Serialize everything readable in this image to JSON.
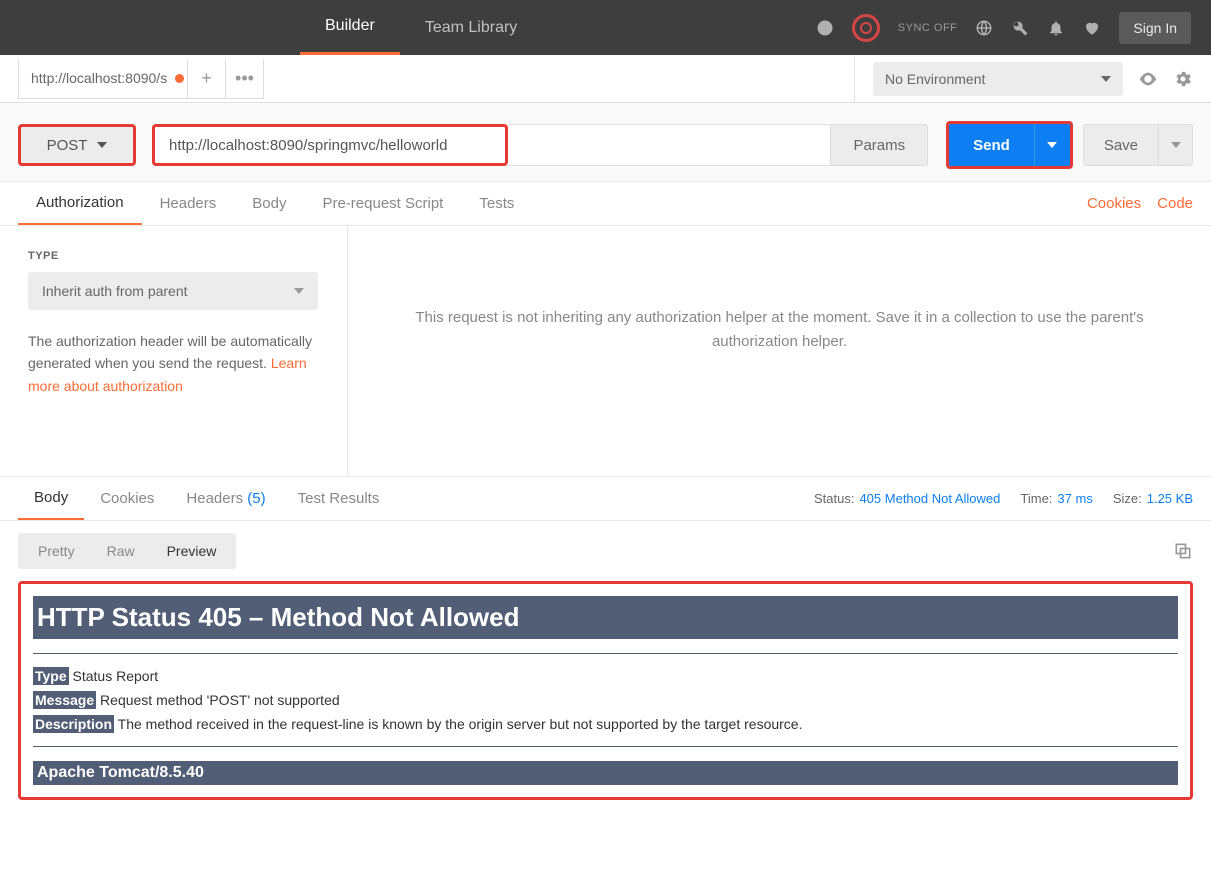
{
  "header": {
    "tabs": {
      "builder": "Builder",
      "teamLibrary": "Team Library"
    },
    "sync": "SYNC OFF",
    "signIn": "Sign In"
  },
  "fileTab": {
    "label": "http://localhost:8090/s"
  },
  "env": {
    "selected": "No Environment"
  },
  "request": {
    "method": "POST",
    "url": "http://localhost:8090/springmvc/helloworld",
    "params": "Params",
    "send": "Send",
    "save": "Save"
  },
  "reqTabs": {
    "authorization": "Authorization",
    "headers": "Headers",
    "body": "Body",
    "preRequest": "Pre-request Script",
    "tests": "Tests",
    "cookies": "Cookies",
    "code": "Code"
  },
  "auth": {
    "typeLabel": "TYPE",
    "typeValue": "Inherit auth from parent",
    "desc1": "The authorization header will be automatically generated when you send the request. ",
    "learnMore": "Learn more about authorization",
    "rightMsg": "This request is not inheriting any authorization helper at the moment. Save it in a collection to use the parent's authorization helper."
  },
  "respTabs": {
    "body": "Body",
    "cookies": "Cookies",
    "headers": "Headers",
    "headersCount": "(5)",
    "testResults": "Test Results"
  },
  "respMeta": {
    "statusLabel": "Status:",
    "statusValue": "405 Method Not Allowed",
    "timeLabel": "Time:",
    "timeValue": "37 ms",
    "sizeLabel": "Size:",
    "sizeValue": "1.25 KB"
  },
  "viewTabs": {
    "pretty": "Pretty",
    "raw": "Raw",
    "preview": "Preview"
  },
  "errorPage": {
    "heading": "HTTP Status 405 – Method Not Allowed",
    "typeLabel": "Type",
    "typeValue": " Status Report",
    "messageLabel": "Message",
    "messageValue": " Request method 'POST' not supported",
    "descLabel": "Description",
    "descValue": " The method received in the request-line is known by the origin server but not supported by the target resource.",
    "server": "Apache Tomcat/8.5.40"
  }
}
